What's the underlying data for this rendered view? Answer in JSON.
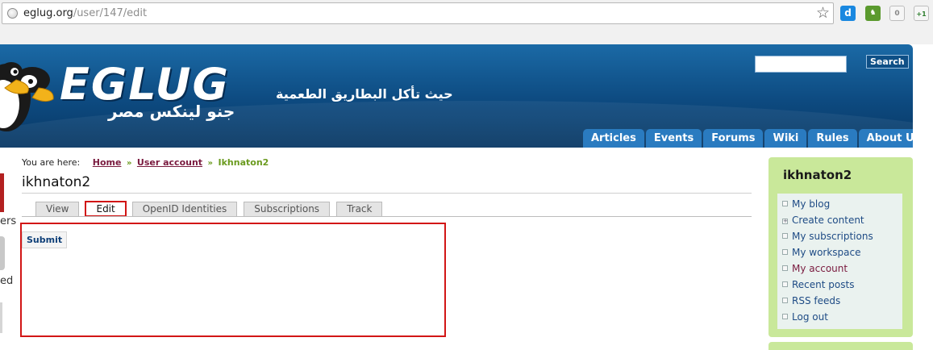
{
  "browser": {
    "url_host": "eglug.org",
    "url_path": "/user/147/edit",
    "ext_count": "0",
    "ext_plus": "+1"
  },
  "header": {
    "logo_text": "EGLUG",
    "logo_subtitle": "جنو لينكس مصر",
    "slogan": "حيث تأكل البطاريق الطعمية",
    "search_label": "Search"
  },
  "primary_nav": [
    "Articles",
    "Events",
    "Forums",
    "Wiki",
    "Rules",
    "About Us"
  ],
  "left_clip": {
    "text1": "ers",
    "text2": "ed"
  },
  "breadcrumb": {
    "label": "You are here:",
    "items": [
      "Home",
      "User account"
    ],
    "current": "Ikhnaton2",
    "separator": "»"
  },
  "page": {
    "title": "ikhnaton2",
    "tabs": [
      "View",
      "Edit",
      "OpenID Identities",
      "Subscriptions",
      "Track"
    ],
    "active_tab": "Edit",
    "submit_label": "Submit"
  },
  "user_block": {
    "name": "ikhnaton2",
    "items": [
      "My blog",
      "Create content",
      "My subscriptions",
      "My workspace",
      "My account",
      "Recent posts",
      "RSS feeds",
      "Log out"
    ],
    "active_item": "My account"
  },
  "colors": {
    "banner": "#0d4a80",
    "nav_tab": "#2a7bc0",
    "sidebar_green": "#c9e89a",
    "highlight_red": "#d21616",
    "breadcrumb_current": "#6a9a1e"
  }
}
